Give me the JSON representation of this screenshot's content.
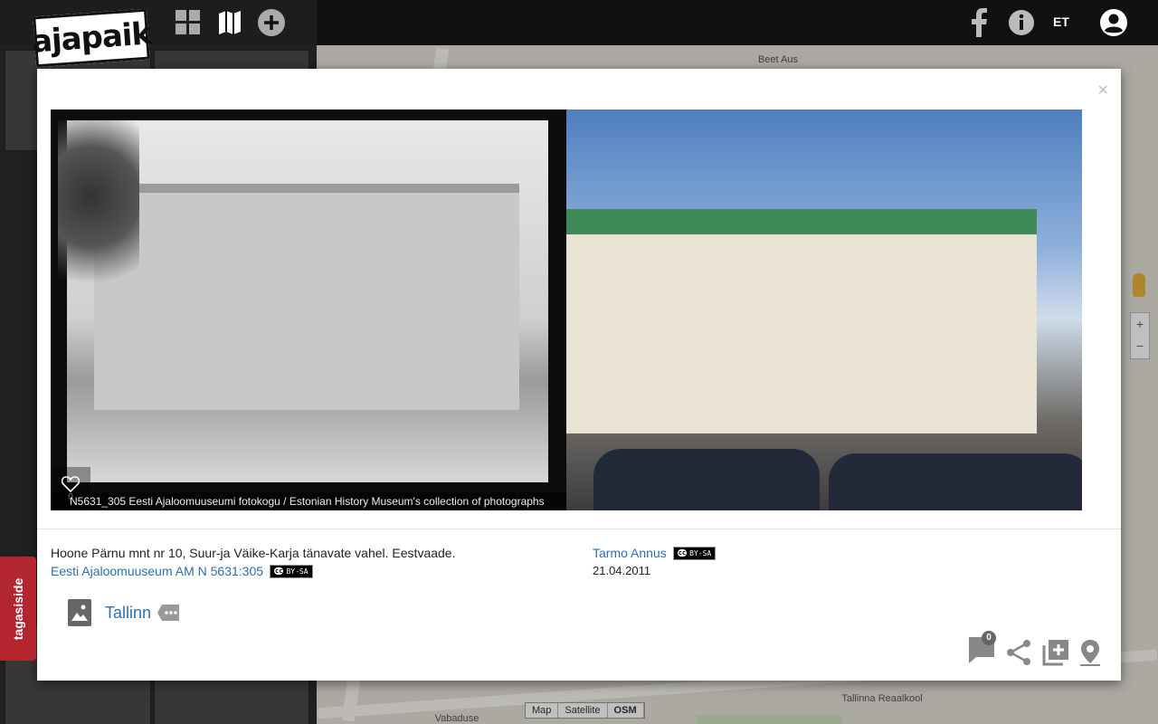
{
  "header": {
    "logo": "ajapaik",
    "language": "ET"
  },
  "modal": {
    "close_label": "×",
    "photo_caption": "N5631_305 Eesti Ajaloomuuseumi fotokogu / Estonian History Museum's collection of photographs",
    "like_count": "0",
    "old_photo": {
      "description": "Hoone Pärnu mnt nr 10, Suur-ja Väike-Karja tänavate vahel. Eestvaade.",
      "source_link": "Eesti Ajaloomuuseum AM N 5631:305",
      "license": "BY-SA"
    },
    "rephoto": {
      "author": "Tarmo Annus",
      "license": "BY-SA",
      "date": "21.04.2011"
    },
    "album": {
      "name": "Tallinn"
    },
    "comments_count": "0"
  },
  "map": {
    "type_buttons": [
      "Map",
      "Satellite",
      "OSM"
    ],
    "active_type": "OSM",
    "labels": {
      "poi_top": "Beet Aus",
      "reaalkool": "Tallinna Reaalkool",
      "vabaduse": "Vabaduse"
    }
  },
  "feedback_label": "tagasiside",
  "colors": {
    "link": "#2f6fad",
    "feedback": "#b3262f",
    "header": "#111111"
  }
}
